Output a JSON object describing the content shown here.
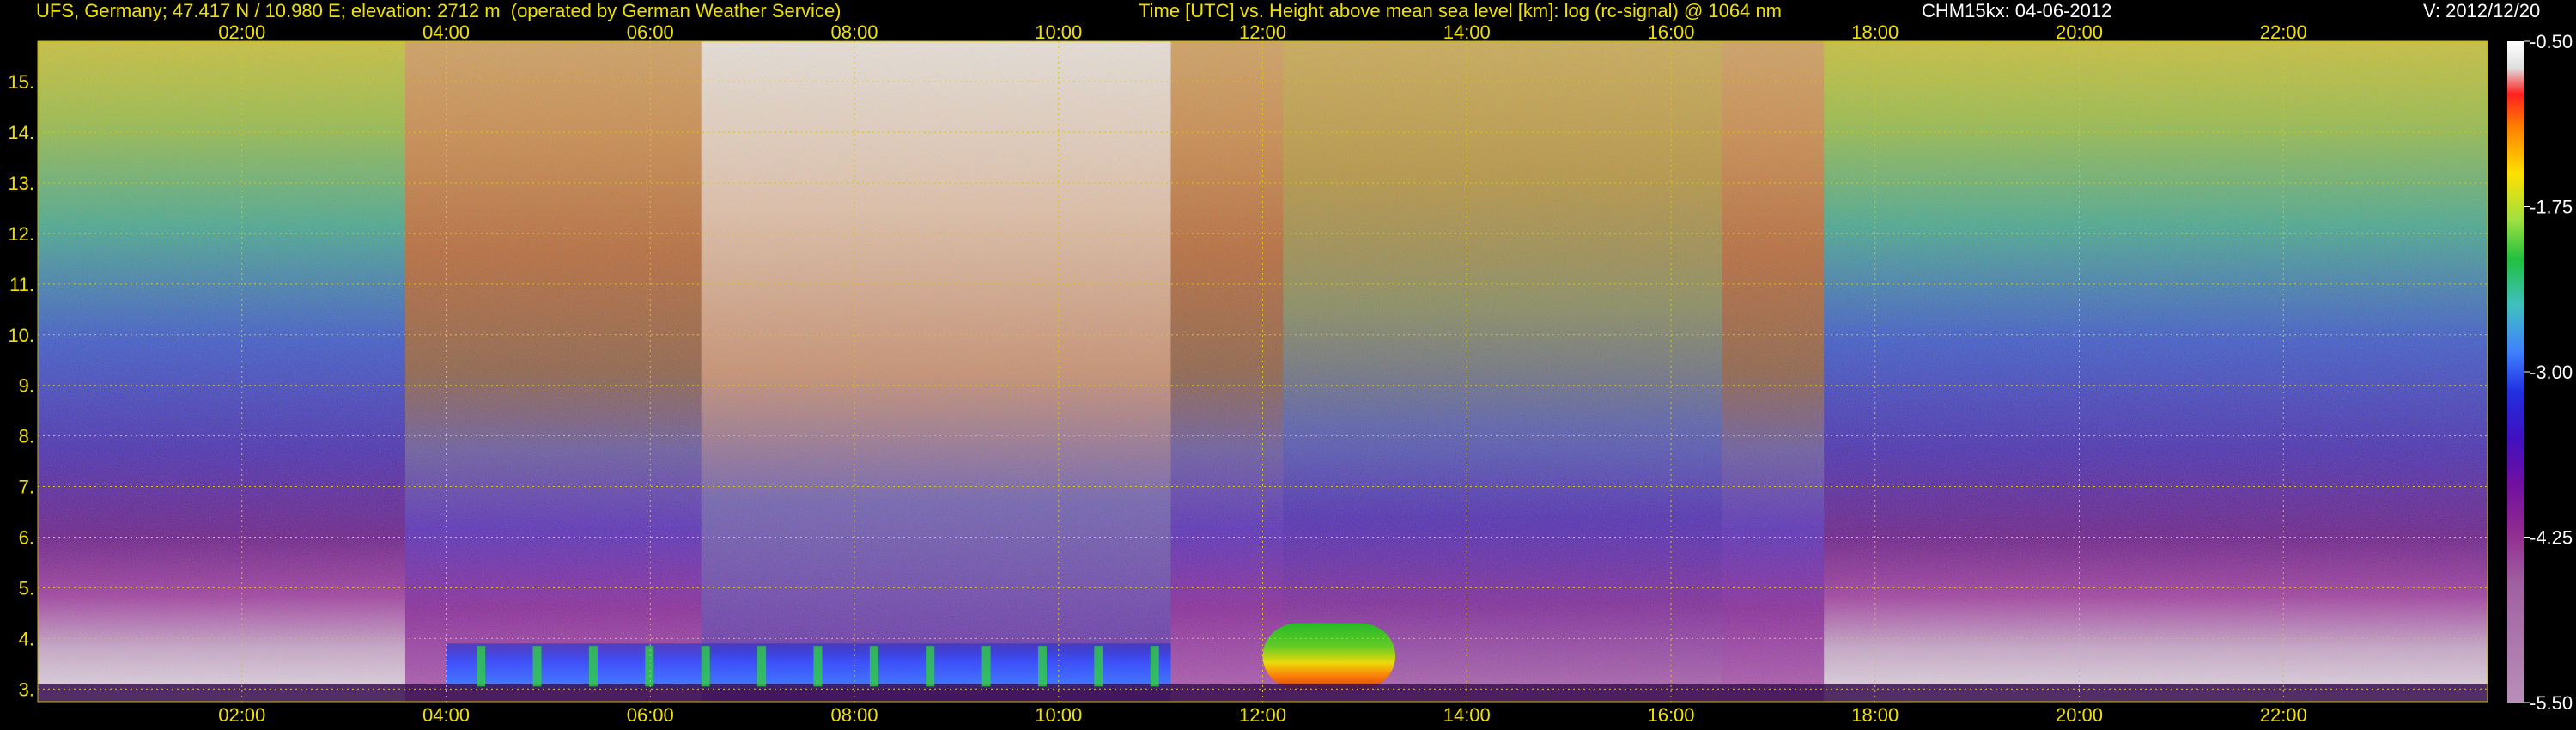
{
  "header": {
    "station": "UFS, Germany; 47.417 N / 10.980 E; elevation: 2712 m  (operated by German Weather Service)",
    "description": "Time [UTC] vs. Height above mean sea level [km]: log (rc-signal) @ 1064 nm",
    "instrument": "CHM15kx: 04-06-2012",
    "version": "V: 2012/12/20"
  },
  "colors": {
    "axis_text": "#f0e000",
    "header_white": "#ffffff",
    "grid": "#d8c800",
    "background": "#000000"
  },
  "chart_data": {
    "type": "heatmap",
    "title": "Time [UTC] vs. Height above mean sea level [km]: log (rc-signal) @ 1064 nm",
    "xlabel": "Time [UTC]",
    "ylabel": "Height above mean sea level [km]",
    "x_ticks": [
      "02:00",
      "04:00",
      "06:00",
      "08:00",
      "10:00",
      "12:00",
      "14:00",
      "16:00",
      "18:00",
      "20:00",
      "22:00"
    ],
    "x_tick_hours": [
      2,
      4,
      6,
      8,
      10,
      12,
      14,
      16,
      18,
      20,
      22
    ],
    "xlim_hours": [
      0,
      24
    ],
    "y_ticks": [
      3,
      4,
      5,
      6,
      7,
      8,
      9,
      10,
      11,
      12,
      13,
      14,
      15
    ],
    "y_tick_labels": [
      "3.",
      "4.",
      "5.",
      "6.",
      "7.",
      "8.",
      "9.",
      "10.",
      "11.",
      "12.",
      "13.",
      "14.",
      "15."
    ],
    "ylim_km": [
      2.75,
      15.8
    ],
    "grid": true,
    "colorbar": {
      "tick_values": [
        -0.5,
        -1.75,
        -3.0,
        -4.25,
        -5.5
      ],
      "tick_labels": [
        "-0.50",
        "-1.75",
        "-3.00",
        "-4.25",
        "-5.50"
      ],
      "range": [
        -5.5,
        -0.5
      ]
    },
    "features": [
      {
        "name": "boundary layer aerosol",
        "from_hour": 4.0,
        "to_hour": 11.1,
        "base_km": 3.0,
        "top_km": 3.9
      },
      {
        "name": "convective plume",
        "from_hour": 12.0,
        "to_hour": 13.3,
        "base_km": 3.0,
        "top_km": 4.3
      },
      {
        "name": "surface layer",
        "from_hour": 0.0,
        "to_hour": 24.0,
        "base_km": 2.75,
        "top_km": 3.1
      }
    ]
  }
}
